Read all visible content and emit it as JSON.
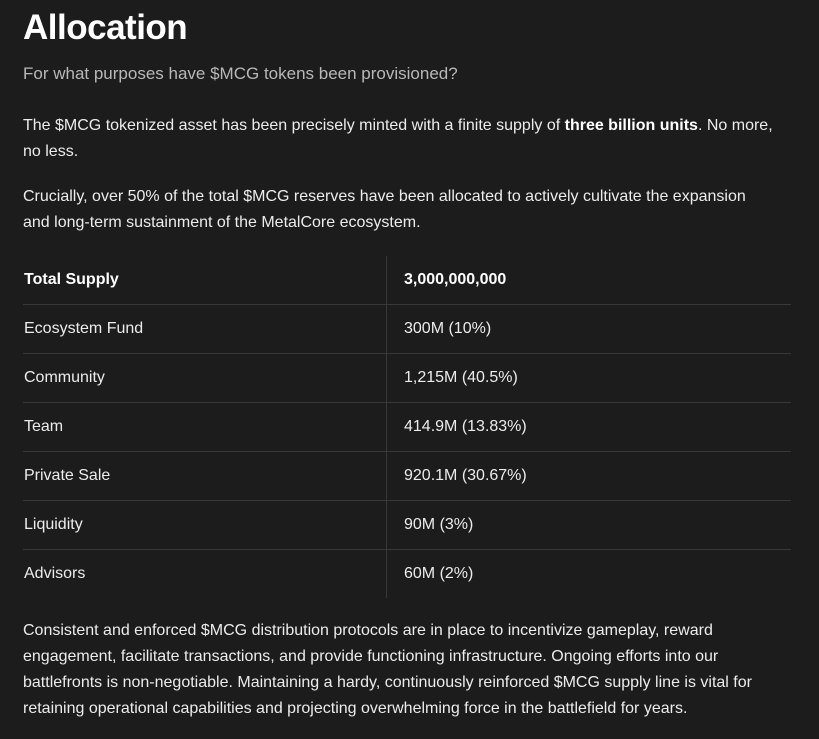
{
  "heading": {
    "title": "Allocation",
    "subtitle": "For what purposes have $MCG tokens been provisioned?"
  },
  "intro": {
    "p1_before": "The $MCG tokenized asset has been precisely minted with a finite supply of ",
    "p1_bold": "three billion units",
    "p1_after": ". No more, no less.",
    "p2": "Crucially, over 50% of the total $MCG reserves have been allocated to actively cultivate the expansion and long-term sustainment of the MetalCore ecosystem."
  },
  "table": {
    "header": {
      "label": "Total Supply",
      "value": "3,000,000,000"
    },
    "rows": [
      {
        "label": "Ecosystem Fund",
        "value": "300M (10%)"
      },
      {
        "label": "Community",
        "value": "1,215M (40.5%)"
      },
      {
        "label": "Team",
        "value": "414.9M (13.83%)"
      },
      {
        "label": "Private Sale",
        "value": "920.1M (30.67%)"
      },
      {
        "label": "Liquidity",
        "value": "90M (3%)"
      },
      {
        "label": "Advisors",
        "value": "60M (2%)"
      }
    ]
  },
  "outro": {
    "p3": "Consistent and enforced $MCG distribution protocols are in place to incentivize gameplay, reward engagement, facilitate transactions, and provide functioning infrastructure. Ongoing efforts into our battlefronts is non-negotiable. Maintaining a hardy, continuously reinforced $MCG supply line is vital for retaining operational capabilities and projecting overwhelming force in the battlefield for years."
  }
}
